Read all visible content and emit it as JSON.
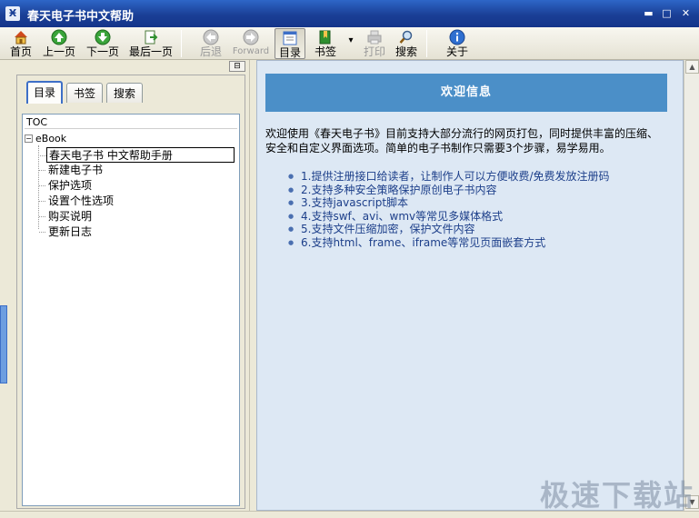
{
  "window": {
    "title": "春天电子书中文帮助",
    "app_icon": "Ӿ"
  },
  "window_controls": {
    "minimize": "▬",
    "maximize": "□",
    "close": "✕"
  },
  "toolbar": {
    "home": "首页",
    "prev": "上一页",
    "next": "下一页",
    "last": "最后一页",
    "back": "后退",
    "forward": "Forward",
    "toc": "目录",
    "bookmark": "书签",
    "dropdown": "▾",
    "print": "打印",
    "search": "搜索",
    "about": "关于"
  },
  "left_panel": {
    "pin": "⊟",
    "tabs": [
      "目录",
      "书签",
      "搜索"
    ],
    "tree_header": "TOC",
    "root_expander": "−",
    "root_label": "eBook",
    "items": [
      "春天电子书 中文帮助手册",
      "新建电子书",
      "保护选项",
      "设置个性选项",
      "购买说明",
      "更新日志"
    ]
  },
  "content": {
    "banner": "欢迎信息",
    "intro": "欢迎使用《春天电子书》目前支持大部分流行的网页打包，同时提供丰富的压缩、安全和自定义界面选项。简单的电子书制作只需要3个步骤，易学易用。",
    "features": [
      "1.提供注册接口给读者，让制作人可以方便收费/免费发放注册码",
      "2.支持多种安全策略保护原创电子书内容",
      "3.支持javascript脚本",
      "4.支持swf、avi、wmv等常见多媒体格式",
      "5.支持文件压缩加密，保护文件内容",
      "6.支持html、frame、iframe等常见页面嵌套方式"
    ]
  },
  "scrollbar": {
    "up": "▲",
    "down": "▼"
  },
  "watermark": "极速下载站"
}
